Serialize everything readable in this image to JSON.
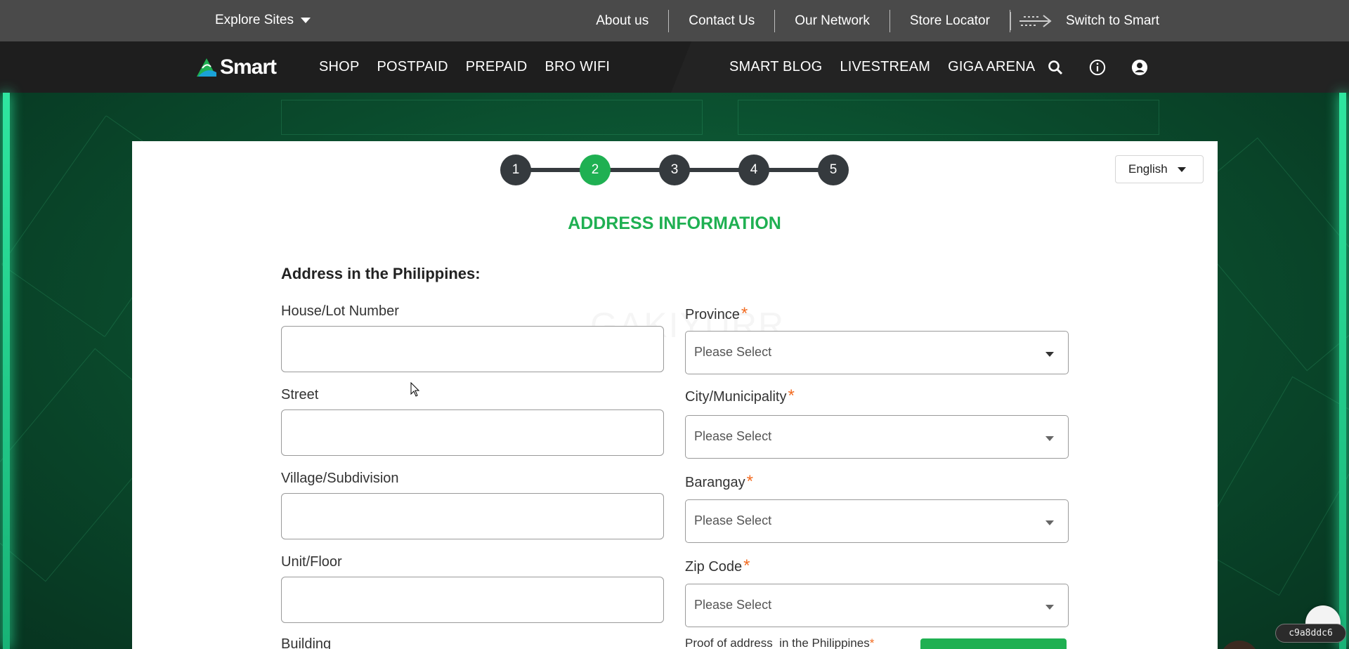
{
  "utility_bar": {
    "explore_label": "Explore Sites",
    "links": [
      "About us",
      "Contact Us",
      "Our Network",
      "Store Locator"
    ],
    "switch_label": "Switch to Smart"
  },
  "main_nav": {
    "logo_text": "Smart",
    "left_items": [
      "SHOP",
      "POSTPAID",
      "PREPAID",
      "BRO WIFI"
    ],
    "right_items": [
      "SMART BLOG",
      "LIVESTREAM",
      "GIGA ARENA"
    ],
    "icons": [
      "search-icon",
      "info-icon",
      "account-icon"
    ]
  },
  "stepper": {
    "steps": [
      "1",
      "2",
      "3",
      "4",
      "5"
    ],
    "active_step": 2
  },
  "language": {
    "selected": "English"
  },
  "form": {
    "section_title": "ADDRESS INFORMATION",
    "watermark": "GAKIYURR",
    "subheading": "Address in the Philippines:",
    "left_fields": [
      {
        "label": "House/Lot Number",
        "value": ""
      },
      {
        "label": "Street",
        "value": ""
      },
      {
        "label": "Village/Subdivision",
        "value": ""
      },
      {
        "label": "Unit/Floor",
        "value": ""
      },
      {
        "label": "Building",
        "value": ""
      }
    ],
    "right_fields": [
      {
        "label": "Province",
        "required": "*",
        "placeholder": "Please Select"
      },
      {
        "label": "City/Municipality",
        "required": "*",
        "placeholder": "Please Select"
      },
      {
        "label": "Barangay",
        "required": "*",
        "placeholder": "Please Select"
      },
      {
        "label": "Zip Code",
        "required": "*",
        "placeholder": "Please Select"
      }
    ],
    "proof_label": "Proof of address  in the Philippines",
    "proof_required": "*"
  },
  "version_badge": "c9a8ddc6",
  "colors": {
    "brand_green": "#1fb052",
    "required_orange": "#f26b21",
    "utility_bar_bg": "#4a4a4a",
    "nav_bg": "#1e1e1e",
    "step_inactive": "#353a3e"
  }
}
